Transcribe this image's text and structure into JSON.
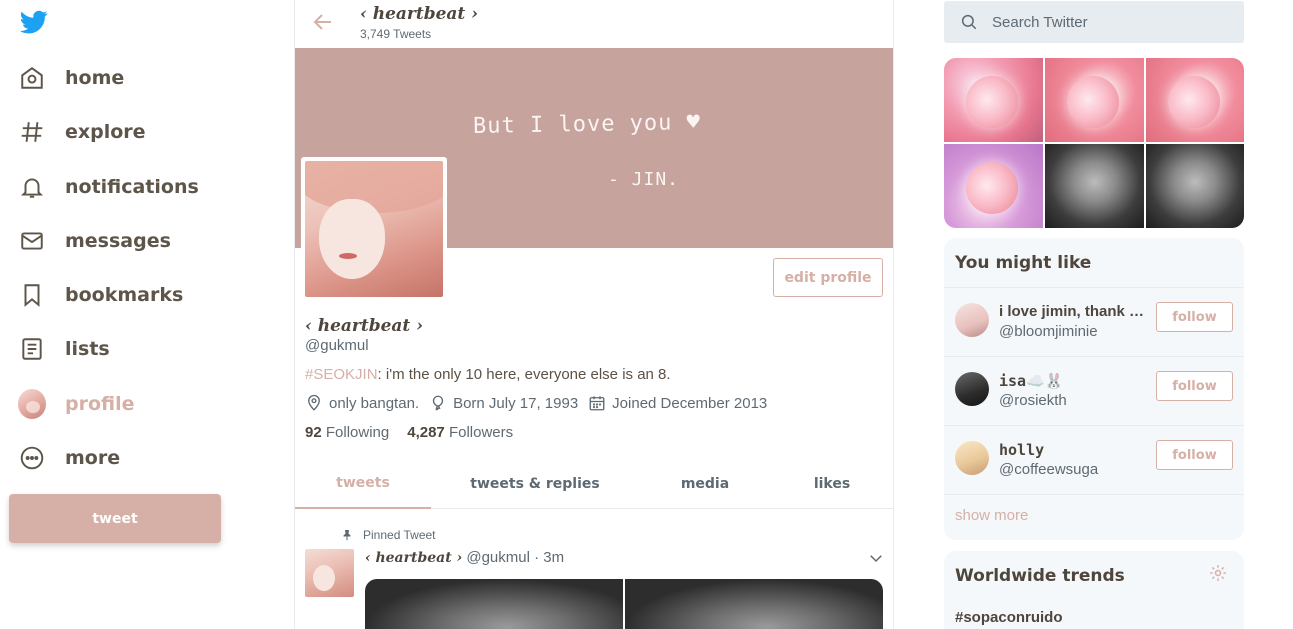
{
  "nav": {
    "items": [
      {
        "label": "home",
        "icon": "home-icon"
      },
      {
        "label": "explore",
        "icon": "hashtag-icon"
      },
      {
        "label": "notifications",
        "icon": "bell-icon"
      },
      {
        "label": "messages",
        "icon": "envelope-icon"
      },
      {
        "label": "bookmarks",
        "icon": "bookmark-icon"
      },
      {
        "label": "lists",
        "icon": "list-icon"
      },
      {
        "label": "profile",
        "icon": "avatar"
      },
      {
        "label": "more",
        "icon": "more-icon"
      }
    ],
    "tweet_label": "tweet"
  },
  "header": {
    "title": "‹ heartbeat ›",
    "tweet_count": "3,749 Tweets"
  },
  "banner": {
    "line1": "But I love you ♥",
    "line2": "- JIN."
  },
  "profile": {
    "edit_label": "edit profile",
    "name": "‹ heartbeat ›",
    "handle": "@gukmul",
    "bio_tag": "#SEOKJIN",
    "bio_text": ": i'm the only 10 here, everyone else is an 8.",
    "location": "only bangtan.",
    "birthday": "Born July 17, 1993",
    "joined": "Joined December 2013",
    "following_count": "92",
    "following_label": "Following",
    "followers_count": "4,287",
    "followers_label": "Followers"
  },
  "tabs": [
    "tweets",
    "tweets & replies",
    "media",
    "likes"
  ],
  "tweet": {
    "pinned_label": "Pinned Tweet",
    "name": "‹ heartbeat ›",
    "meta": "@gukmul · 3m"
  },
  "search": {
    "placeholder": "Search Twitter"
  },
  "who_to_follow": {
    "title": "You might like",
    "items": [
      {
        "name": "i love jimin, thank god",
        "handle": "@bloomjiminie"
      },
      {
        "name": "isa☁️🐰",
        "handle": "@rosiekth"
      },
      {
        "name": "holly",
        "handle": "@coffeewsuga"
      }
    ],
    "follow_label": "follow",
    "show_more": "show more"
  },
  "trends": {
    "title": "Worldwide trends",
    "items": [
      "#sopaconruido"
    ]
  },
  "colors": {
    "accent": "#d6afa7",
    "banner": "#c6a39d",
    "text": "#5e554a",
    "muted": "#5e6a73",
    "logo": "#1da1f2"
  }
}
